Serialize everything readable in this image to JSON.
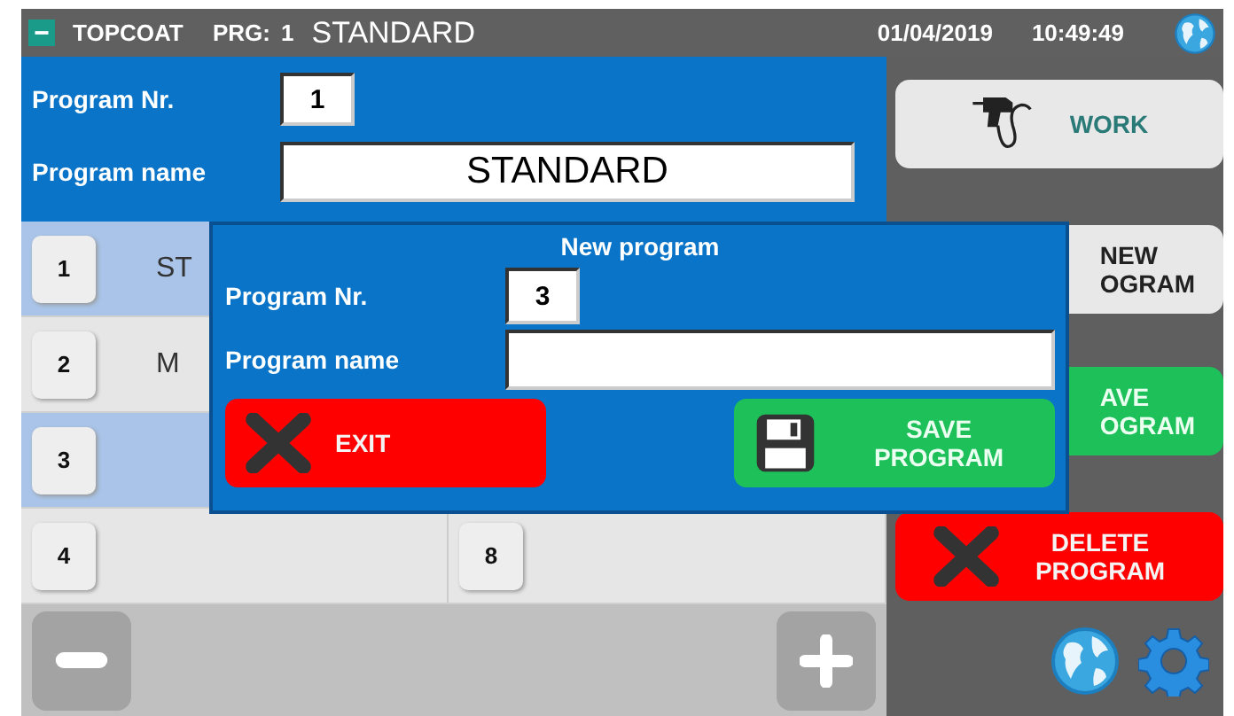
{
  "header": {
    "app": "TOPCOAT",
    "program_label": "PRG:",
    "program_number": "1",
    "program_name": "STANDARD",
    "date": "01/04/2019",
    "time": "10:49:49"
  },
  "program_form": {
    "fields": [
      {
        "label": "Program Nr.",
        "value": "1",
        "kind": "short"
      },
      {
        "label": "Program name",
        "value": "STANDARD",
        "kind": "wide"
      }
    ]
  },
  "program_list": {
    "rows": [
      {
        "cells": [
          {
            "number": "1",
            "name": "ST",
            "selected": true
          }
        ]
      },
      {
        "cells": [
          {
            "number": "2",
            "name": "M",
            "selected": false
          }
        ]
      },
      {
        "cells": [
          {
            "number": "3",
            "selected": true
          }
        ]
      },
      {
        "cells": [
          {
            "number": "4",
            "selected": false
          },
          {
            "number": "8",
            "selected": false
          }
        ]
      }
    ]
  },
  "sidebar": {
    "buttons": [
      {
        "kind": "work",
        "label_lines": [
          "WORK"
        ]
      },
      {
        "kind": "new",
        "label_lines": [
          "NEW",
          "OGRAM"
        ]
      },
      {
        "kind": "save",
        "label_lines": [
          "AVE",
          "OGRAM"
        ]
      },
      {
        "kind": "delete",
        "label_lines": [
          "DELETE",
          "PROGRAM"
        ]
      }
    ]
  },
  "dialog": {
    "title": "New program",
    "fields": [
      {
        "label": "Program Nr.",
        "value": "3",
        "kind": "short"
      },
      {
        "label": "Program name",
        "kind": "wide"
      }
    ],
    "buttons": [
      {
        "kind": "exit",
        "label_lines": [
          "EXIT"
        ]
      },
      {
        "kind": "save",
        "label_lines": [
          "SAVE",
          "PROGRAM"
        ]
      }
    ]
  }
}
